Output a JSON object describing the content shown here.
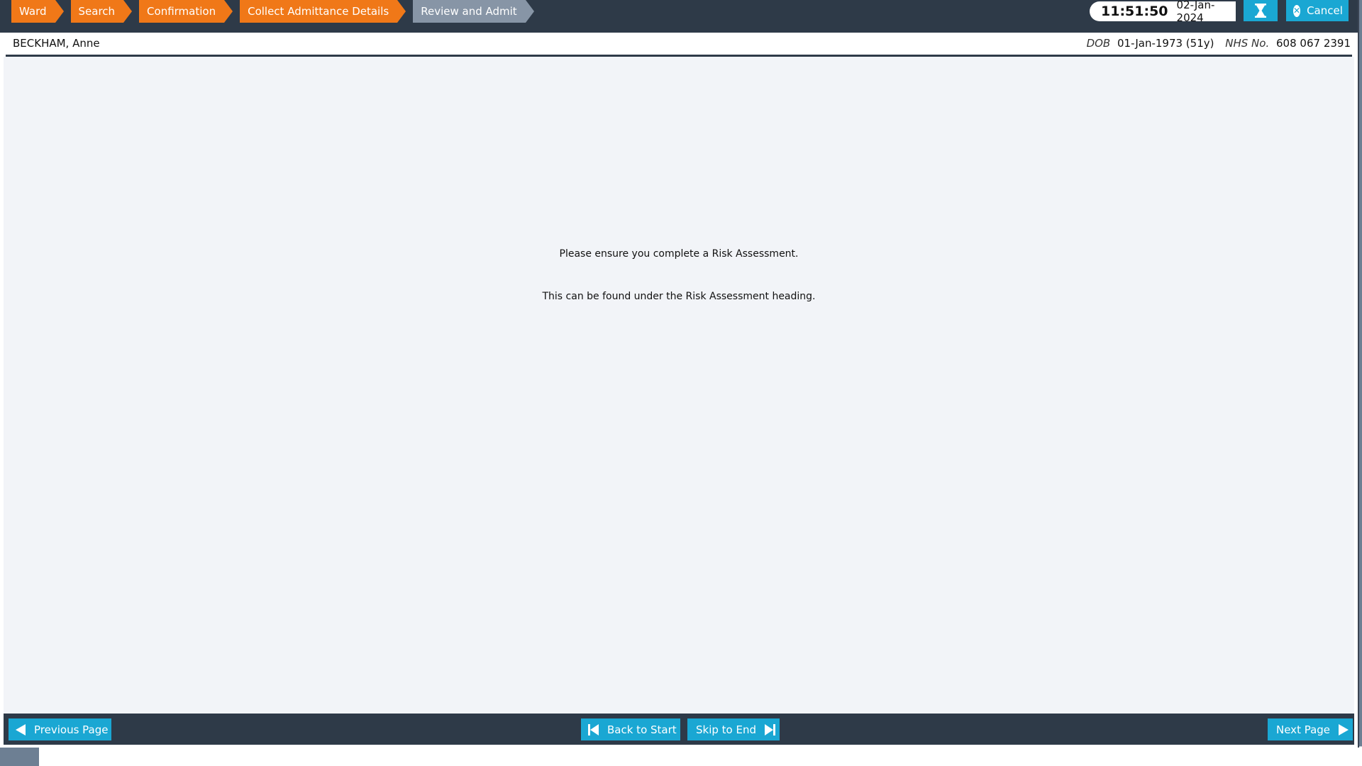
{
  "breadcrumbs": [
    {
      "label": "Ward"
    },
    {
      "label": "Search"
    },
    {
      "label": "Confirmation"
    },
    {
      "label": "Collect Admittance Details"
    },
    {
      "label": "Review and Admit",
      "current": true
    }
  ],
  "header": {
    "time": "11:51:50",
    "date": "02-Jan-2024",
    "filter_icon": "hourglass-icon",
    "cancel_label": "Cancel",
    "cancel_icon": "close-circle-icon"
  },
  "patient": {
    "name": "BECKHAM, Anne",
    "dob_label": "DOB",
    "dob_value": "01-Jan-1973 (51y)",
    "nhs_label": "NHS No.",
    "nhs_value": "608 067 2391"
  },
  "content": {
    "message_1": "Please ensure you complete a Risk Assessment.",
    "message_2": "This can be found under the Risk Assessment heading."
  },
  "footer": {
    "previous_label": "Previous Page",
    "back_to_start_label": "Back to Start",
    "skip_to_end_label": "Skip to End",
    "next_label": "Next Page"
  },
  "colors": {
    "crumb_active": "#f07818",
    "crumb_current": "#8795a6",
    "topbar": "#2e3a48",
    "button": "#1aa7d3",
    "content_bg": "#f2f4f8"
  }
}
